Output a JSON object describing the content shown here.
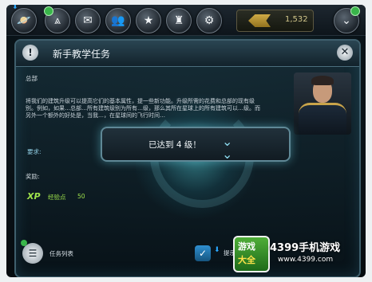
{
  "topbar": {
    "buttons": [
      {
        "name": "planet",
        "glyph": "🪐"
      },
      {
        "name": "fleet",
        "glyph": "⩓"
      },
      {
        "name": "mail",
        "glyph": "✉"
      },
      {
        "name": "alliance",
        "glyph": "👥"
      },
      {
        "name": "rank",
        "glyph": "★"
      },
      {
        "name": "commander",
        "glyph": "♜"
      },
      {
        "name": "settings",
        "glyph": "⚙"
      }
    ],
    "badge_fleet": "",
    "credits": "1,532",
    "collapse_glyph": "⌄"
  },
  "panel": {
    "title": "新手教学任务",
    "info_glyph": "!",
    "close_glyph": "✕",
    "section_main": "总部",
    "body": "将我们的建筑升级可以提高它们的基本属性，提一些新功能。升级所需的花费和总部的现有级别。例如，如果…总部…所有建筑级别为所有…级，那么其所在星球上的所有建筑可以…级。而另外一个额外的好处是，当我…，在星球间的飞行时间…",
    "section_requirement": "要求:",
    "section_reward": "奖励:",
    "xp_icon": "XP",
    "xp_label": "经验点",
    "xp_value": "50",
    "list_label": "任务列表",
    "list_glyph": "☰",
    "hint_label": "提示",
    "hint_glyph": "✓"
  },
  "popup": {
    "text": "已达到 4 级！",
    "chevron": "⌄"
  },
  "watermark": {
    "logo_line1": "游戏",
    "logo_line2": "大全",
    "title": "4399手机游戏",
    "url": "www.4399.com"
  }
}
